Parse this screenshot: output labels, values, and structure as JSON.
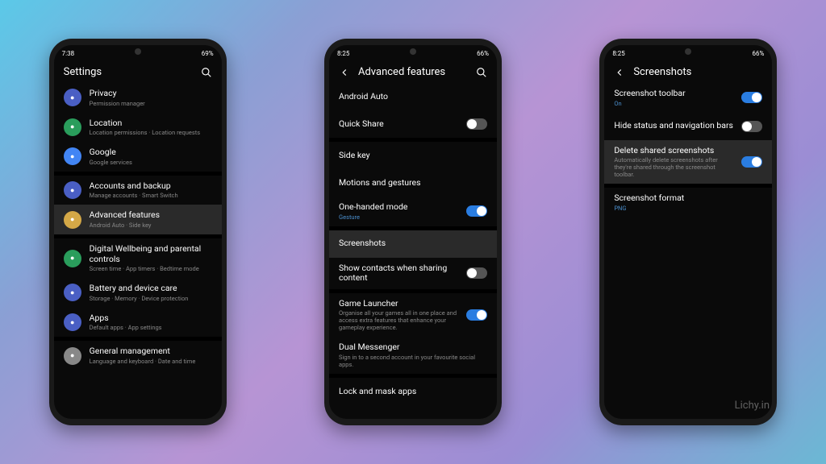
{
  "watermark": "Lichy.in",
  "phones": [
    {
      "time": "7:38",
      "status_right": "69%",
      "title": "Settings",
      "has_back": false,
      "has_search": true,
      "groups": [
        {
          "items": [
            {
              "icon": "privacy",
              "label": "Privacy",
              "sub": "Permission manager"
            },
            {
              "icon": "location",
              "label": "Location",
              "sub": "Location permissions · Location requests"
            },
            {
              "icon": "google",
              "label": "Google",
              "sub": "Google services"
            }
          ]
        },
        {
          "items": [
            {
              "icon": "accounts",
              "label": "Accounts and backup",
              "sub": "Manage accounts · Smart Switch"
            },
            {
              "icon": "advanced",
              "label": "Advanced features",
              "sub": "Android Auto · Side key",
              "highlighted": true
            }
          ]
        },
        {
          "items": [
            {
              "icon": "wellbeing",
              "label": "Digital Wellbeing and parental controls",
              "sub": "Screen time · App timers · Bedtime mode"
            },
            {
              "icon": "battery",
              "label": "Battery and device care",
              "sub": "Storage · Memory · Device protection"
            },
            {
              "icon": "apps",
              "label": "Apps",
              "sub": "Default apps · App settings"
            }
          ]
        },
        {
          "items": [
            {
              "icon": "general",
              "label": "General management",
              "sub": "Language and keyboard · Date and time"
            }
          ]
        }
      ]
    },
    {
      "time": "8:25",
      "status_right": "66%",
      "title": "Advanced features",
      "has_back": true,
      "has_search": true,
      "groups": [
        {
          "items": [
            {
              "label": "Android Auto"
            },
            {
              "label": "Quick Share",
              "toggle": "off"
            }
          ]
        },
        {
          "items": [
            {
              "label": "Side key"
            },
            {
              "label": "Motions and gestures"
            },
            {
              "label": "One-handed mode",
              "sub": "Gesture",
              "sub_blue": true,
              "toggle": "on"
            }
          ]
        },
        {
          "items": [
            {
              "label": "Screenshots",
              "highlighted": true
            },
            {
              "label": "Show contacts when sharing content",
              "toggle": "off"
            }
          ]
        },
        {
          "items": [
            {
              "label": "Game Launcher",
              "sub": "Organise all your games all in one place and access extra features that enhance your gameplay experience.",
              "toggle": "on"
            },
            {
              "label": "Dual Messenger",
              "sub": "Sign in to a second account in your favourite social apps."
            }
          ]
        },
        {
          "items": [
            {
              "label": "Lock and mask apps"
            }
          ]
        }
      ]
    },
    {
      "time": "8:25",
      "status_right": "66%",
      "title": "Screenshots",
      "has_back": true,
      "has_search": false,
      "groups": [
        {
          "items": [
            {
              "label": "Screenshot toolbar",
              "sub": "On",
              "sub_blue": true,
              "toggle": "on"
            },
            {
              "label": "Hide status and navigation bars",
              "toggle": "off"
            },
            {
              "label": "Delete shared screenshots",
              "sub": "Automatically delete screenshots after they're shared through the screenshot toolbar.",
              "toggle": "on",
              "highlighted": true
            }
          ]
        },
        {
          "items": [
            {
              "label": "Screenshot format",
              "sub": "PNG",
              "sub_blue": true
            }
          ]
        }
      ]
    }
  ]
}
